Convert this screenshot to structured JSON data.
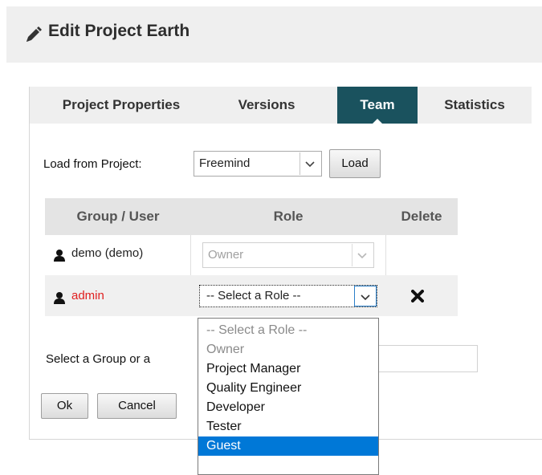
{
  "header": {
    "title": "Edit Project Earth",
    "icon": "pencil-icon"
  },
  "tabs": [
    {
      "label": "Project Properties",
      "active": false
    },
    {
      "label": "Versions",
      "active": false
    },
    {
      "label": "Team",
      "active": true
    },
    {
      "label": "Statistics",
      "active": false
    }
  ],
  "load_row": {
    "label": "Load from Project:",
    "project_value": "Freemind",
    "load_button": "Load"
  },
  "team_table": {
    "columns": [
      "Group / User",
      "Role",
      "Delete"
    ],
    "rows": [
      {
        "user": "demo (demo)",
        "role": "Owner",
        "role_disabled": true,
        "deletable": false
      },
      {
        "user": "admin",
        "role": "-- Select a Role --",
        "role_disabled": false,
        "deletable": true,
        "user_color": "#e02020"
      }
    ]
  },
  "role_dropdown": {
    "options": [
      {
        "label": "-- Select a Role --",
        "disabled": true
      },
      {
        "label": "Owner",
        "disabled": true
      },
      {
        "label": "Project Manager"
      },
      {
        "label": "Quality Engineer"
      },
      {
        "label": "Developer"
      },
      {
        "label": "Tester"
      },
      {
        "label": "Guest",
        "highlighted": true
      }
    ]
  },
  "add_row": {
    "label": "Select a Group or a"
  },
  "footer": {
    "ok_button": "Ok",
    "cancel_button": "Cancel"
  },
  "colors": {
    "tab_active": "#1a525e",
    "highlight": "#0078d7",
    "admin_name": "#e02020",
    "header_bg": "#efefef"
  }
}
